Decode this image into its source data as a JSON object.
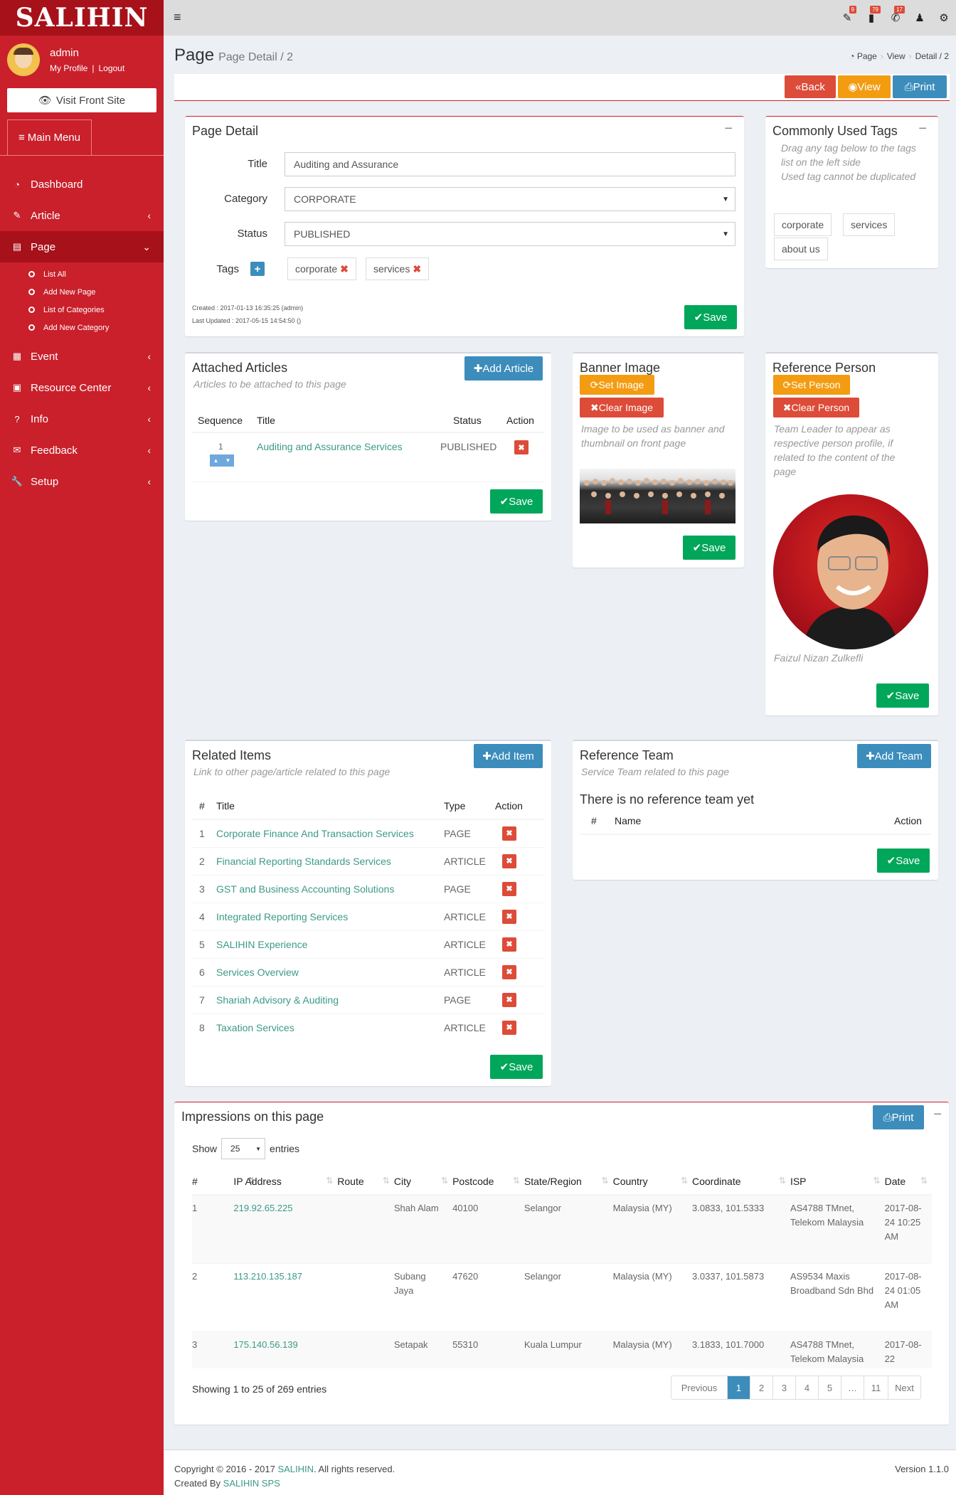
{
  "brand": {
    "name": "SALIHIN"
  },
  "user": {
    "name": "admin",
    "profile_link": "My Profile",
    "logout_link": "Logout"
  },
  "sidebar": {
    "visit_label": "Visit Front Site",
    "main_menu_label": "Main Menu",
    "items": [
      {
        "label": "Dashboard",
        "icon": "dashboard-icon"
      },
      {
        "label": "Article",
        "icon": "pencil-icon"
      },
      {
        "label": "Page",
        "icon": "newspaper-icon"
      },
      {
        "label": "Event",
        "icon": "calendar-icon"
      },
      {
        "label": "Resource Center",
        "icon": "film-icon"
      },
      {
        "label": "Info",
        "icon": "question-icon"
      },
      {
        "label": "Feedback",
        "icon": "envelope-icon"
      },
      {
        "label": "Setup",
        "icon": "wrench-icon"
      }
    ],
    "page_sub": [
      "List All",
      "Add New Page",
      "List of Categories",
      "Add New Category"
    ]
  },
  "topbar": {
    "badges": [
      "9",
      "79",
      "17"
    ]
  },
  "header": {
    "title": "Page",
    "subtitle": "Page Detail / 2",
    "breadcrumb": [
      "Page",
      "View",
      "Detail / 2"
    ]
  },
  "actions": {
    "back": "Back",
    "view": "View",
    "print": "Print"
  },
  "page_detail": {
    "title": "Page Detail",
    "labels": {
      "title": "Title",
      "category": "Category",
      "status": "Status",
      "tags": "Tags"
    },
    "title_value": "Auditing and Assurance",
    "category_value": "CORPORATE",
    "status_value": "PUBLISHED",
    "tags": [
      "corporate",
      "services"
    ],
    "created": "Created : 2017-01-13 16:35:25 (admin)",
    "updated": "Last Updated : 2017-05-15 14:54:50 ()",
    "save": "Save"
  },
  "common_tags": {
    "title": "Commonly Used Tags",
    "hint1": "Drag any tag below to the tags list on the left side",
    "hint2": "Used tag cannot be duplicated",
    "tags": [
      "corporate",
      "services",
      "about us"
    ]
  },
  "attached": {
    "title": "Attached Articles",
    "sub": "Articles to be attached to this page",
    "add": "Add Article",
    "headers": [
      "Sequence",
      "Title",
      "Status",
      "Action"
    ],
    "rows": [
      {
        "seq": "1",
        "title": "Auditing and Assurance Services",
        "status": "PUBLISHED"
      }
    ],
    "save": "Save"
  },
  "banner": {
    "title": "Banner Image",
    "set": "Set Image",
    "clear": "Clear Image",
    "hint": "Image to be used as banner and thumbnail on front page",
    "save": "Save"
  },
  "reference_person": {
    "title": "Reference Person",
    "set": "Set Person",
    "clear": "Clear Person",
    "hint": "Team Leader to appear as respective person profile, if related to the content of the page",
    "name": "Faizul Nizan Zulkefli",
    "save": "Save"
  },
  "related": {
    "title": "Related Items",
    "sub": "Link to other page/article related to this page",
    "add": "Add Item",
    "headers": [
      "#",
      "Title",
      "Type",
      "Action"
    ],
    "rows": [
      {
        "n": "1",
        "title": "Corporate Finance And Transaction Services",
        "type": "PAGE"
      },
      {
        "n": "2",
        "title": "Financial Reporting Standards Services",
        "type": "ARTICLE"
      },
      {
        "n": "3",
        "title": "GST and Business Accounting Solutions",
        "type": "PAGE"
      },
      {
        "n": "4",
        "title": "Integrated Reporting Services",
        "type": "ARTICLE"
      },
      {
        "n": "5",
        "title": "SALIHIN Experience",
        "type": "ARTICLE"
      },
      {
        "n": "6",
        "title": "Services Overview",
        "type": "ARTICLE"
      },
      {
        "n": "7",
        "title": "Shariah Advisory & Auditing",
        "type": "PAGE"
      },
      {
        "n": "8",
        "title": "Taxation Services",
        "type": "ARTICLE"
      }
    ],
    "save": "Save"
  },
  "ref_team": {
    "title": "Reference Team",
    "sub": "Service Team related to this page",
    "add": "Add Team",
    "empty": "There is no reference team yet",
    "headers": [
      "#",
      "Name",
      "Action"
    ],
    "save": "Save"
  },
  "impressions": {
    "title": "Impressions on this page",
    "print": "Print",
    "show": "Show",
    "entries_value": "25",
    "entries": "entries",
    "headers": [
      "#",
      "IP Address",
      "Route",
      "City",
      "Postcode",
      "State/Region",
      "Country",
      "Coordinate",
      "ISP",
      "Date"
    ],
    "rows": [
      {
        "n": "1",
        "ip": "219.92.65.225",
        "route": "",
        "city": "Shah Alam",
        "postcode": "40100",
        "state": "Selangor",
        "country": "Malaysia (MY)",
        "coord": "3.0833, 101.5333",
        "isp": "AS4788 TMnet, Telekom Malaysia",
        "date": "2017-08-24 10:25 AM"
      },
      {
        "n": "2",
        "ip": "113.210.135.187",
        "route": "",
        "city": "Subang Jaya",
        "postcode": "47620",
        "state": "Selangor",
        "country": "Malaysia (MY)",
        "coord": "3.0337, 101.5873",
        "isp": "AS9534 Maxis Broadband Sdn Bhd",
        "date": "2017-08-24 01:05 AM"
      },
      {
        "n": "3",
        "ip": "175.140.56.139",
        "route": "",
        "city": "Setapak",
        "postcode": "55310",
        "state": "Kuala Lumpur",
        "country": "Malaysia (MY)",
        "coord": "3.1833, 101.7000",
        "isp": "AS4788 TMnet, Telekom Malaysia",
        "date": "2017-08-22"
      }
    ],
    "info": "Showing 1 to 25 of 269 entries",
    "pager": [
      "Previous",
      "1",
      "2",
      "3",
      "4",
      "5",
      "…",
      "11",
      "Next"
    ]
  },
  "footer": {
    "copyright_pre": "Copyright © 2016 - 2017",
    "copyright_brand": "SALIHIN",
    "copyright_post": ". All rights reserved.",
    "created_pre": "Created By",
    "created_brand": "SALIHIN SPS",
    "version": "Version 1.1.0"
  },
  "colors": {
    "brand_red": "#c9202b",
    "green": "#00a65a",
    "blue": "#3c8dbc",
    "orange": "#f39c12",
    "link": "#3c9a87"
  }
}
